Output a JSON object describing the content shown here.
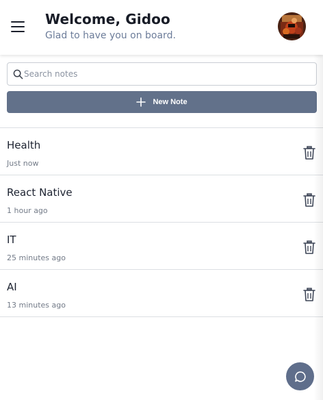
{
  "header": {
    "title": "Welcome, Gidoo",
    "subtitle": "Glad to have you on board.",
    "menu_icon": "hamburger-menu-icon",
    "avatar_icon": "user-avatar"
  },
  "search": {
    "placeholder": "Search notes",
    "value": "",
    "icon": "search-icon"
  },
  "new_note": {
    "label": "New Note",
    "icon": "plus-icon"
  },
  "notes": [
    {
      "title": "Health",
      "time": "Just now"
    },
    {
      "title": "React Native",
      "time": "1 hour ago"
    },
    {
      "title": "IT",
      "time": "25 minutes ago"
    },
    {
      "title": "AI",
      "time": "13 minutes ago"
    }
  ],
  "note_action_icon": "trash-icon",
  "fab": {
    "icon": "chat-bubble-icon"
  },
  "colors": {
    "accent": "#62718a",
    "fab": "#5f6e8b",
    "subtitle": "#6d7d9a",
    "divider": "#dcdfe3"
  }
}
